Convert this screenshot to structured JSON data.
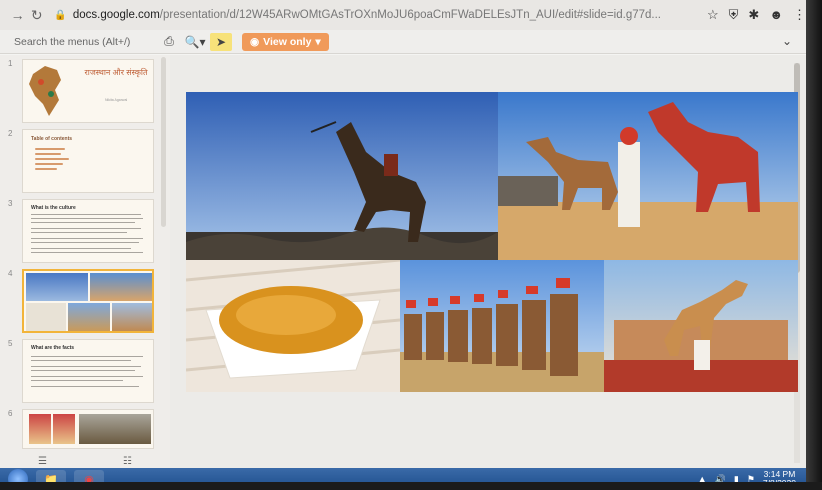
{
  "browser": {
    "url_host": "docs.google.com",
    "url_path": "/presentation/d/12W45ARwOMtGAsTrOXnMoJU6poaCmFWaDELEsJTn_AUI/edit#slide=id.g77d...",
    "icons": [
      "back-icon",
      "reload-icon",
      "lock-icon",
      "star-icon",
      "shield-icon",
      "puzzle-icon",
      "profile-icon",
      "menu-icon"
    ]
  },
  "toolbar": {
    "search_placeholder": "Search the menus (Alt+/)",
    "view_only_label": "View only"
  },
  "filmstrip": {
    "slides": [
      {
        "num": "1",
        "title": "राजस्थान और संस्कृति",
        "subtitle": "Nikita Agarwal"
      },
      {
        "num": "2",
        "title": "Table of contents"
      },
      {
        "num": "3",
        "title": "What is the culture"
      },
      {
        "num": "4",
        "title": ""
      },
      {
        "num": "5",
        "title": "What are the facts"
      },
      {
        "num": "6",
        "title": ""
      }
    ],
    "selected": "4"
  },
  "taskbar": {
    "time": "3:14 PM",
    "date": "7/8/2020"
  },
  "colors": {
    "view_only_bg": "#f09a5a",
    "selected_thumb": "#f2b43a"
  }
}
